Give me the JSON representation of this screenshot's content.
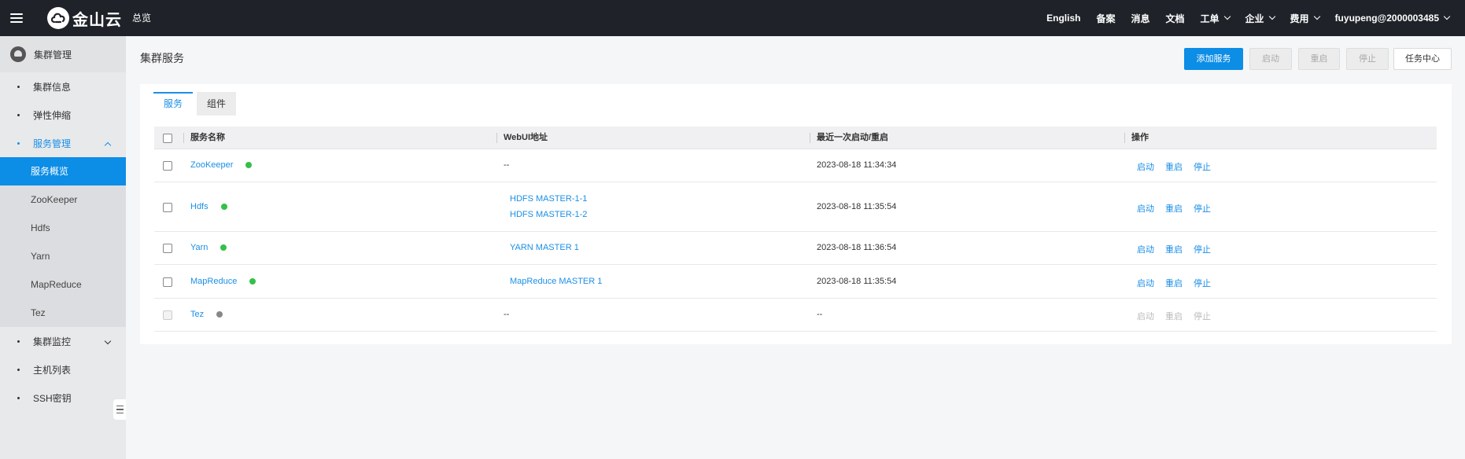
{
  "topbar": {
    "brand": "金山云",
    "overview": "总览",
    "items": [
      {
        "label": "English",
        "dropdown": false
      },
      {
        "label": "备案",
        "dropdown": false
      },
      {
        "label": "消息",
        "dropdown": false
      },
      {
        "label": "文档",
        "dropdown": false
      },
      {
        "label": "工单",
        "dropdown": true
      },
      {
        "label": "企业",
        "dropdown": true
      },
      {
        "label": "费用",
        "dropdown": true
      },
      {
        "label": "fuyupeng@2000003485",
        "dropdown": true
      }
    ]
  },
  "sidebar": {
    "header": "集群管理",
    "items": {
      "cluster_info": "集群信息",
      "elastic": "弹性伸缩",
      "service_mgmt": "服务管理",
      "cluster_monitor": "集群监控",
      "host_list": "主机列表",
      "ssh_key": "SSH密钥"
    },
    "subitems": [
      "服务概览",
      "ZooKeeper",
      "Hdfs",
      "Yarn",
      "MapReduce",
      "Tez"
    ]
  },
  "page": {
    "title": "集群服务",
    "buttons": {
      "add": "添加服务",
      "start": "启动",
      "restart": "重启",
      "stop": "停止",
      "tasks": "任务中心"
    },
    "tabs": [
      "服务",
      "组件"
    ]
  },
  "table": {
    "headers": {
      "name": "服务名称",
      "webui": "WebUI地址",
      "last_start": "最近一次启动/重启",
      "actions": "操作"
    },
    "rows": [
      {
        "name": "ZooKeeper",
        "status": "running",
        "webui": [
          "--"
        ],
        "webui_link": false,
        "time": "2023-08-18 11:34:34",
        "ops": [
          "启动",
          "重启",
          "停止"
        ],
        "enabled": true
      },
      {
        "name": "Hdfs",
        "status": "running",
        "webui": [
          "HDFS MASTER-1-1",
          "HDFS MASTER-1-2"
        ],
        "webui_link": true,
        "time": "2023-08-18 11:35:54",
        "ops": [
          "启动",
          "重启",
          "停止"
        ],
        "enabled": true
      },
      {
        "name": "Yarn",
        "status": "running",
        "webui": [
          "YARN MASTER 1"
        ],
        "webui_link": true,
        "time": "2023-08-18 11:36:54",
        "ops": [
          "启动",
          "重启",
          "停止"
        ],
        "enabled": true
      },
      {
        "name": "MapReduce",
        "status": "running",
        "webui": [
          "MapReduce MASTER 1"
        ],
        "webui_link": true,
        "time": "2023-08-18 11:35:54",
        "ops": [
          "启动",
          "重启",
          "停止"
        ],
        "enabled": true
      },
      {
        "name": "Tez",
        "status": "stopped",
        "webui": [
          "--"
        ],
        "webui_link": false,
        "time": "--",
        "ops": [
          "启动",
          "重启",
          "停止"
        ],
        "enabled": false
      }
    ]
  },
  "colors": {
    "primary": "#0c8de6",
    "topbar": "#1f2329",
    "status_running": "#33c149",
    "status_stopped": "#888888"
  }
}
